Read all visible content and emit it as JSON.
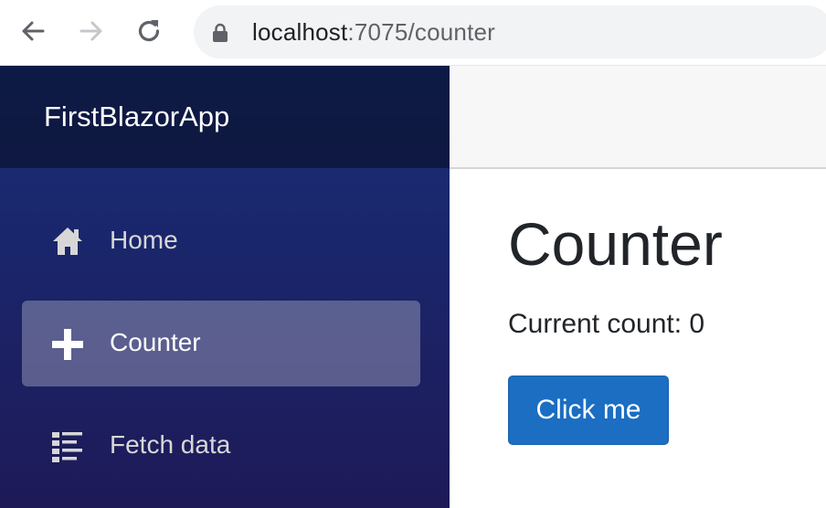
{
  "browser": {
    "back_icon": "arrow-left-icon",
    "forward_icon": "arrow-right-icon",
    "reload_icon": "reload-icon",
    "lock_icon": "lock-icon",
    "url_host": "localhost",
    "url_path": ":7075/counter"
  },
  "sidebar": {
    "brand": "FirstBlazorApp",
    "items": [
      {
        "label": "Home",
        "icon": "home-icon",
        "active": false
      },
      {
        "label": "Counter",
        "icon": "plus-icon",
        "active": true
      },
      {
        "label": "Fetch data",
        "icon": "list-icon",
        "active": false
      }
    ]
  },
  "main": {
    "title": "Counter",
    "count_label": "Current count: 0",
    "button_label": "Click me"
  },
  "colors": {
    "sidebar_top": "#182e78",
    "sidebar_bottom": "#1e1a58",
    "button_primary": "#1b6ec2"
  }
}
